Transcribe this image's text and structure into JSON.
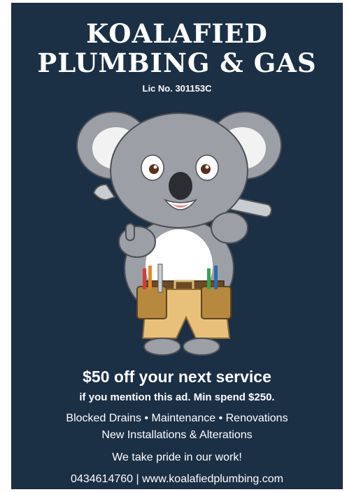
{
  "ad": {
    "title_line1": "KOALAFIED",
    "title_line2": "PLUMBING & GAS",
    "license": "Lic No. 301153C",
    "offer_headline": "$50 off your next service",
    "offer_terms": "if you mention this ad. Min spend $250.",
    "services_line1": "Blocked Drains • Maintenance • Renovations",
    "services_line2": "New Installations & Alterations",
    "tagline": "We take pride in our work!",
    "contact": "0434614760  |  www.koalafiedplumbing.com"
  },
  "colors": {
    "background": "#1b2f45",
    "text": "#ffffff",
    "koala_fur": "#9c9fa6",
    "shorts": "#e8c07a"
  },
  "mascot": {
    "icon": "koala-plumber-mascot"
  }
}
